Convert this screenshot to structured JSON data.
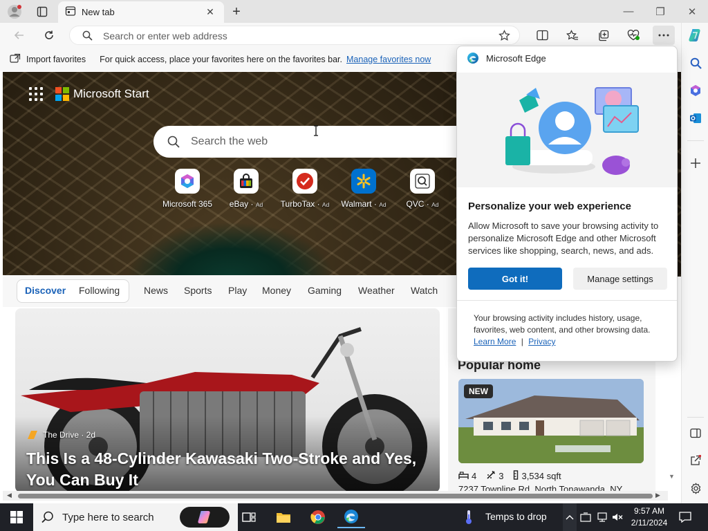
{
  "browser": {
    "tab": {
      "title": "New tab"
    },
    "address_bar": {
      "placeholder": "Search or enter web address"
    },
    "favorites_bar": {
      "import_label": "Import favorites",
      "message": "For quick access, place your favorites here on the favorites bar.",
      "manage_link": "Manage favorites now"
    },
    "colors": {
      "accent": "#0f6cbd",
      "link": "#1a62b8"
    }
  },
  "page": {
    "brand": "Microsoft Start",
    "search_placeholder": "Search the web",
    "quick_links": [
      {
        "label": "Microsoft 365",
        "ad": ""
      },
      {
        "label": "eBay",
        "ad": "Ad"
      },
      {
        "label": "TurboTax",
        "ad": "Ad"
      },
      {
        "label": "Walmart",
        "ad": "Ad"
      },
      {
        "label": "QVC",
        "ad": "Ad"
      }
    ],
    "feed_tabs": [
      "Discover",
      "Following",
      "News",
      "Sports",
      "Play",
      "Money",
      "Gaming",
      "Weather",
      "Watch"
    ],
    "main_card": {
      "source": "The Drive · 2d",
      "title": "This Is a 48-Cylinder Kawasaki Two-Stroke and Yes, You Can Buy It"
    },
    "popular_home": {
      "title": "Popular home",
      "badge": "NEW",
      "beds": "4",
      "baths": "3",
      "sqft": "3,534 sqft",
      "address": "7237 Townline Rd, North Tonawanda, NY"
    }
  },
  "flyout": {
    "header": "Microsoft Edge",
    "title": "Personalize your web experience",
    "body": "Allow Microsoft to save your browsing activity to personalize Microsoft Edge and other Microsoft services like shopping, search, news, and ads.",
    "primary_button": "Got it!",
    "secondary_button": "Manage settings",
    "footer": "Your browsing activity includes history, usage, favorites, web content, and other browsing data.",
    "learn_more": "Learn More",
    "separator": "|",
    "privacy": "Privacy"
  },
  "taskbar": {
    "search_placeholder": "Type here to search",
    "weather": "Temps to drop",
    "time": "9:57 AM",
    "date": "2/11/2024"
  }
}
